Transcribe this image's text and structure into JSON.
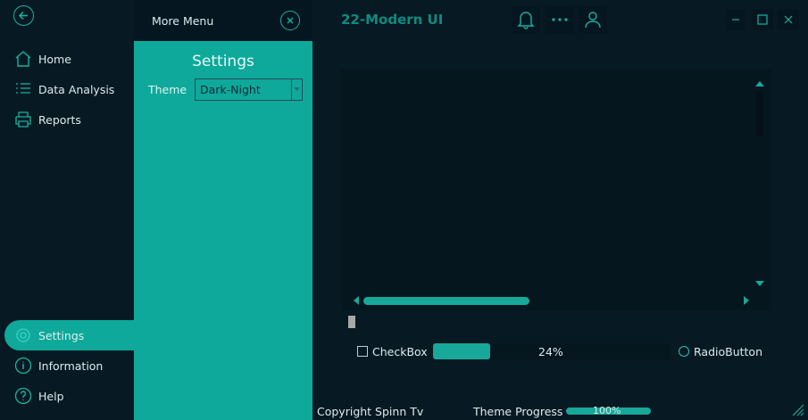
{
  "app": {
    "title": "22-Modern UI"
  },
  "sidebar": {
    "items": [
      {
        "label": "Home",
        "icon": "home-icon"
      },
      {
        "label": "Data Analysis",
        "icon": "list-icon"
      },
      {
        "label": "Reports",
        "icon": "printer-icon"
      },
      {
        "label": "Settings",
        "icon": "gear-icon",
        "active": true
      },
      {
        "label": "Information",
        "icon": "info-icon"
      },
      {
        "label": "Help",
        "icon": "help-icon"
      }
    ]
  },
  "more_menu": {
    "title": "More Menu",
    "settings_title": "Settings",
    "theme_label": "Theme",
    "theme_value": "Dark-Night"
  },
  "controls": {
    "checkbox_label": "CheckBox",
    "progress_percent": 24,
    "progress_text": "24%",
    "radio_label": "RadioButton"
  },
  "footer": {
    "copyright": "Copyright Spinn Tv",
    "theme_progress_label": "Theme Progress",
    "theme_progress_percent": 100,
    "theme_progress_text": "100%"
  },
  "colors": {
    "accent": "#0ea99b",
    "background": "#071922",
    "title": "#0c8c82"
  }
}
